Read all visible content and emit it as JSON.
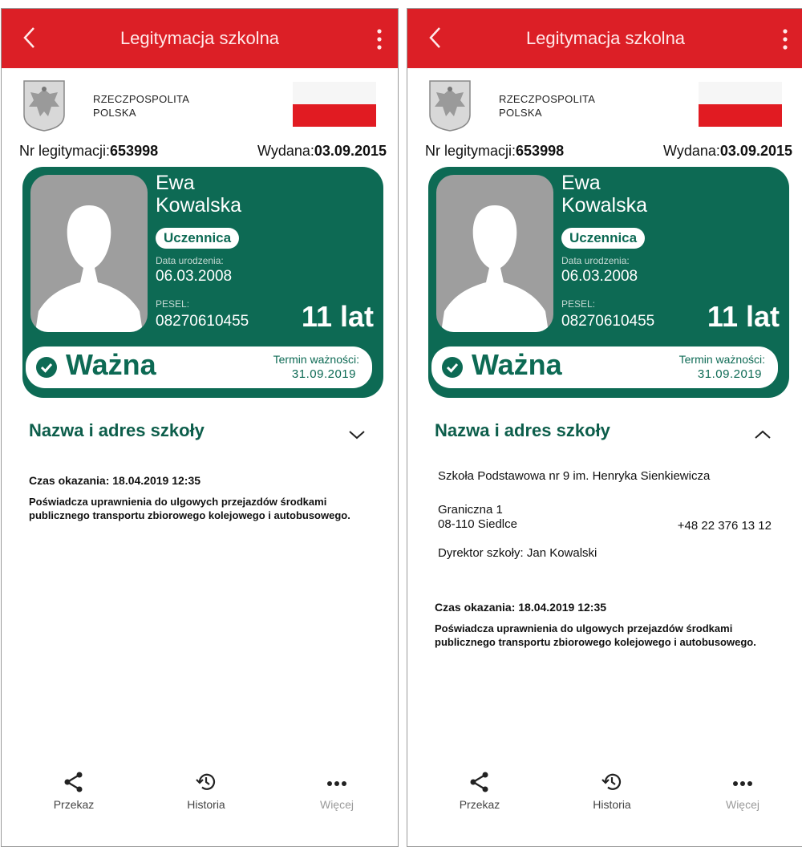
{
  "header": {
    "title": "Legitymacja szkolna"
  },
  "country": {
    "name": "RZECZPOSPOLITA\nPOLSKA"
  },
  "id_number": {
    "label": "Nr legitymacji:",
    "value": "653998"
  },
  "issued": {
    "label": "Wydana:",
    "value": "03.09.2015"
  },
  "person": {
    "first_name": "Ewa",
    "last_name": "Kowalska",
    "role": "Uczennica",
    "dob_label": "Data urodzenia:",
    "dob": "06.03.2008",
    "pesel_label": "PESEL:",
    "pesel": "08270610455",
    "age": "11 lat"
  },
  "status": {
    "label": "Ważna",
    "expiry_label": "Termin ważności:",
    "expiry": "31.09.2019"
  },
  "school": {
    "header": "Nazwa i adres szkoły",
    "name": "Szkoła Podstawowa nr 9 im. Henryka Sienkiewicza",
    "street": "Graniczna 1",
    "city": "08-110 Siedlce",
    "phone": "+48 22 376 13 12",
    "director": "Dyrektor szkoły: Jan Kowalski"
  },
  "shown_time": "Czas okazania: 18.04.2019 12:35",
  "note": "Poświadcza uprawnienia do ulgowych przejazdów środkami publicznego transportu zbiorowego kolejowego i autobusowego.",
  "bottom_nav": {
    "share": "Przekaz",
    "history": "Historia",
    "more": "Więcej"
  },
  "colors": {
    "appbar": "#dc1f26",
    "card": "#0d6a54",
    "flag_red": "#e11b22"
  },
  "icons": [
    "back-arrow-icon",
    "kebab-menu-icon",
    "eagle-emblem-icon",
    "check-circle-icon",
    "chevron-down-icon",
    "chevron-up-icon",
    "share-icon",
    "history-icon",
    "more-dots-icon"
  ]
}
